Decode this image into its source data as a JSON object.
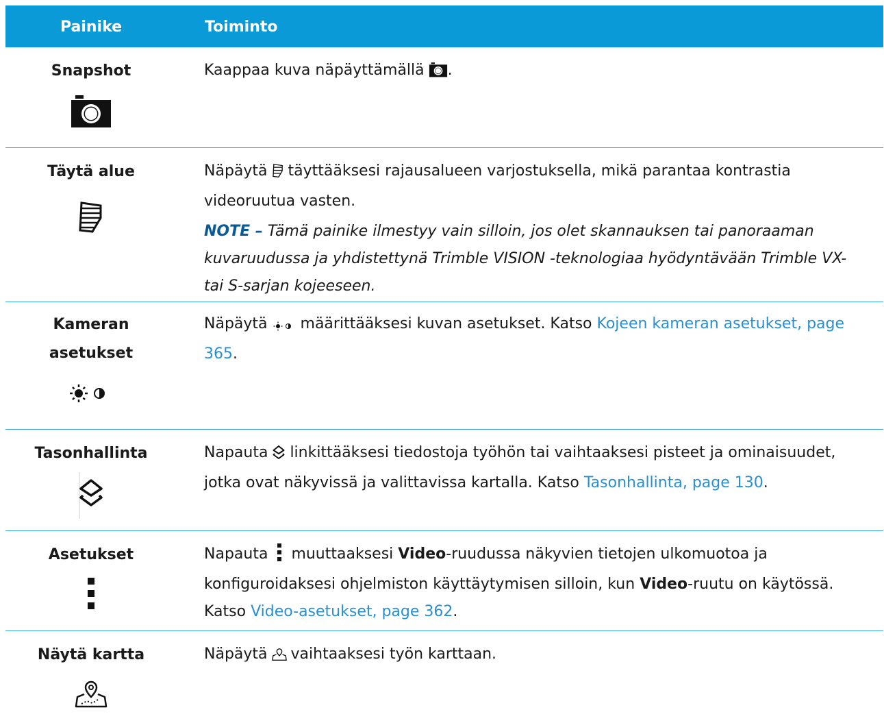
{
  "header": {
    "col1": "Painike",
    "col2": "Toiminto"
  },
  "rows": [
    {
      "name": "Snapshot",
      "icon": "camera-icon",
      "desc_a": "Kaappaa kuva näpäyttämällä",
      "desc_b": "."
    },
    {
      "name": "Täytä alue",
      "icon": "fill-area-icon",
      "desc_a": "Näpäytä",
      "desc_b": "täyttääksesi rajausalueen varjostuksella, mikä parantaa kontrastia videoruutua vasten.",
      "note_label": "NOTE –",
      "note_text": "Tämä painike ilmestyy vain silloin, jos olet skannauksen tai panoraaman kuvaruudussa ja yhdistettynä Trimble VISION -teknologiaa hyödyntävään Trimble VX- tai S-sarjan kojeeseen."
    },
    {
      "name_line1": "Kameran",
      "name_line2": "asetukset",
      "icon": "brightness-contrast-icon",
      "desc_a": "Näpäytä",
      "desc_b": "määrittääksesi kuvan asetukset. Katso",
      "link": "Kojeen kameran asetukset, page 365",
      "desc_c": "."
    },
    {
      "name": "Tasonhallinta",
      "icon": "layers-icon",
      "desc_a": "Napauta",
      "desc_b": "linkittääksesi tiedostoja työhön tai vaihtaaksesi pisteet ja ominaisuudet, jotka ovat näkyvissä ja valittavissa kartalla. Katso",
      "link": "Tasonhallinta, page 130",
      "desc_c": "."
    },
    {
      "name": "Asetukset",
      "icon": "more-vertical-icon",
      "desc_a": "Napauta",
      "desc_b": "muuttaaksesi",
      "bold1": "Video",
      "desc_c": "-ruudussa näkyvien tietojen ulkomuotoa ja konfiguroidaksesi ohjelmiston käyttäytymisen silloin, kun",
      "bold2": "Video",
      "desc_d": "-ruutu on käytössä. Katso",
      "link": "Video-asetukset, page 362",
      "desc_e": "."
    },
    {
      "name": "Näytä kartta",
      "icon": "map-icon",
      "desc_a": "Näpäytä",
      "desc_b": "vaihtaaksesi työn karttaan."
    }
  ],
  "colors": {
    "header_bg": "#0a9ad7",
    "divider": "#3aa5d8",
    "link": "#2a8fd0",
    "note_label": "#0a5a95"
  }
}
